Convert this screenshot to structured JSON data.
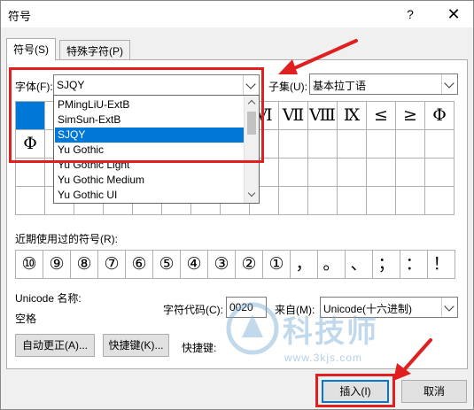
{
  "dialog": {
    "title": "符号",
    "help_label": "?",
    "close_label": "✕"
  },
  "tabs": [
    {
      "label": "符号(S)",
      "active": true
    },
    {
      "label": "特殊字符(P)",
      "active": false
    }
  ],
  "font": {
    "label": "字体(F):",
    "value": "SJQY"
  },
  "subset": {
    "label": "子集(U):",
    "value": "基本拉丁语"
  },
  "font_dropdown": {
    "options": [
      {
        "label": "PMingLiU-ExtB",
        "selected": false
      },
      {
        "label": "SimSun-ExtB",
        "selected": false
      },
      {
        "label": "SJQY",
        "selected": true
      },
      {
        "label": "Yu Gothic",
        "selected": false
      },
      {
        "label": "Yu Gothic Light",
        "selected": false
      },
      {
        "label": "Yu Gothic Medium",
        "selected": false
      },
      {
        "label": "Yu Gothic UI",
        "selected": false
      }
    ]
  },
  "symbol_grid": {
    "rows": [
      [
        "",
        "",
        "",
        "",
        "",
        "",
        "",
        "",
        "Ⅵ",
        "Ⅶ",
        "Ⅷ",
        "Ⅸ",
        "≤",
        "≥",
        "Φ"
      ],
      [
        "Φ",
        "",
        "",
        "",
        "",
        "",
        "",
        "",
        "",
        "",
        "",
        "",
        "",
        "",
        ""
      ],
      [
        "",
        "",
        "",
        "",
        "",
        "",
        "",
        "",
        "",
        "",
        "",
        "",
        "",
        "",
        ""
      ],
      [
        "",
        "",
        "",
        "",
        "",
        "",
        "",
        "",
        "",
        "",
        "",
        "",
        "",
        "",
        ""
      ]
    ]
  },
  "recent": {
    "label": "近期使用过的符号(R):",
    "symbols": [
      "⑩",
      "⑨",
      "⑧",
      "⑦",
      "⑥",
      "⑤",
      "④",
      "③",
      "②",
      "①",
      "，",
      "。",
      "、",
      "；",
      "：",
      "！"
    ]
  },
  "unicode": {
    "name_label": "Unicode 名称:",
    "name_value": "空格",
    "code_label": "字符代码(C):",
    "code_value": "0020",
    "from_label": "来自(M):",
    "from_value": "Unicode(十六进制)"
  },
  "buttons": {
    "autocorrect": "自动更正(A)...",
    "shortcut_key": "快捷键(K)...",
    "shortcut_label": "快捷键:",
    "insert": "插入(I)",
    "cancel": "取消"
  },
  "watermark": {
    "text": "科技师",
    "url": "www.3kjs.com"
  },
  "colors": {
    "accent": "#0078d7",
    "highlight": "#e02020"
  }
}
